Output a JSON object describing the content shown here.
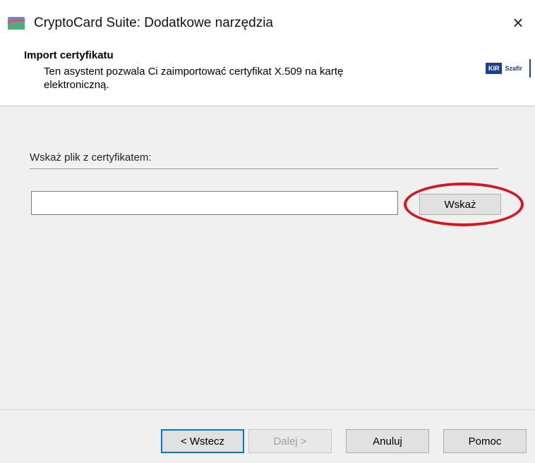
{
  "window": {
    "title": "CryptoCard Suite: Dodatkowe narzędzia",
    "close_symbol": "×"
  },
  "header": {
    "title": "Import certyfikatu",
    "description": "Ten asystent pozwala Ci zaimportować certyfikat X.509 na kartę elektroniczną.",
    "logo_text_1": "KIR",
    "logo_text_2": "Szafir"
  },
  "main": {
    "file_label": "Wskaż plik z certyfikatem:",
    "file_path_value": "",
    "browse_button": "Wskaż",
    "highlight_color": "#d4181f"
  },
  "footer": {
    "back_button": "< Wstecz",
    "next_button": "Dalej >",
    "cancel_button": "Anuluj",
    "help_button": "Pomoc"
  },
  "colors": {
    "accent": "#0078d7",
    "panel": "#f0f0f0"
  },
  "icons": {
    "app": "cryptocard-app-icon",
    "close": "close-icon"
  }
}
